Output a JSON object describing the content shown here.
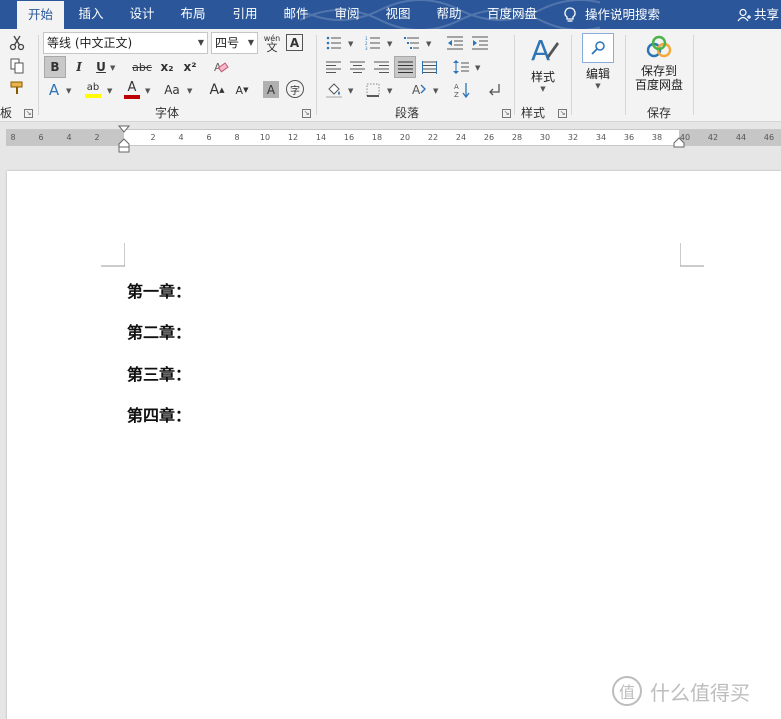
{
  "tabs": [
    {
      "label": "开始",
      "active": true
    },
    {
      "label": "插入"
    },
    {
      "label": "设计"
    },
    {
      "label": "布局"
    },
    {
      "label": "引用"
    },
    {
      "label": "邮件"
    },
    {
      "label": "审阅"
    },
    {
      "label": "视图"
    },
    {
      "label": "帮助"
    },
    {
      "label": "百度网盘"
    }
  ],
  "tell_me": "操作说明搜索",
  "share": "共享",
  "ribbon": {
    "clipboard_label": "板",
    "font": {
      "name": "等线 (中文正文)",
      "size": "四号",
      "phonetic_top": "wén",
      "phonetic_bottom": "文",
      "group_label": "字体",
      "bold": "B",
      "italic": "I",
      "underline": "U",
      "strike": "abc",
      "subscript": "x₂",
      "superscript": "x²",
      "grow": "A",
      "shrink": "A",
      "case": "Aa",
      "shade": "A",
      "circle": "字",
      "font_color_hex": "#c00000",
      "highlight_hex": "#ffff00"
    },
    "paragraph": {
      "group_label": "段落"
    },
    "styles": {
      "label": "样式",
      "group_label": "样式"
    },
    "editing": {
      "label": "编辑"
    },
    "save": {
      "label_line1": "保存到",
      "label_line2": "百度网盘",
      "group_label": "保存"
    }
  },
  "ruler": {
    "left_ticks": [
      "8",
      "6",
      "4",
      "2"
    ],
    "right_ticks": [
      "2",
      "4",
      "6",
      "8",
      "10",
      "12",
      "14",
      "16",
      "18",
      "20",
      "22",
      "24",
      "26",
      "28",
      "30",
      "32",
      "34",
      "36",
      "38",
      "40",
      "42",
      "44",
      "46"
    ]
  },
  "document": {
    "lines": [
      "第一章：",
      "第二章：",
      "第三章：",
      "第四章："
    ]
  },
  "watermark": {
    "text": "什么值得买",
    "icon": "值"
  },
  "colors": {
    "accent": "#2b579a",
    "ribbon_bg": "#f3f3f3",
    "workspace_bg": "#e6e6e6"
  }
}
